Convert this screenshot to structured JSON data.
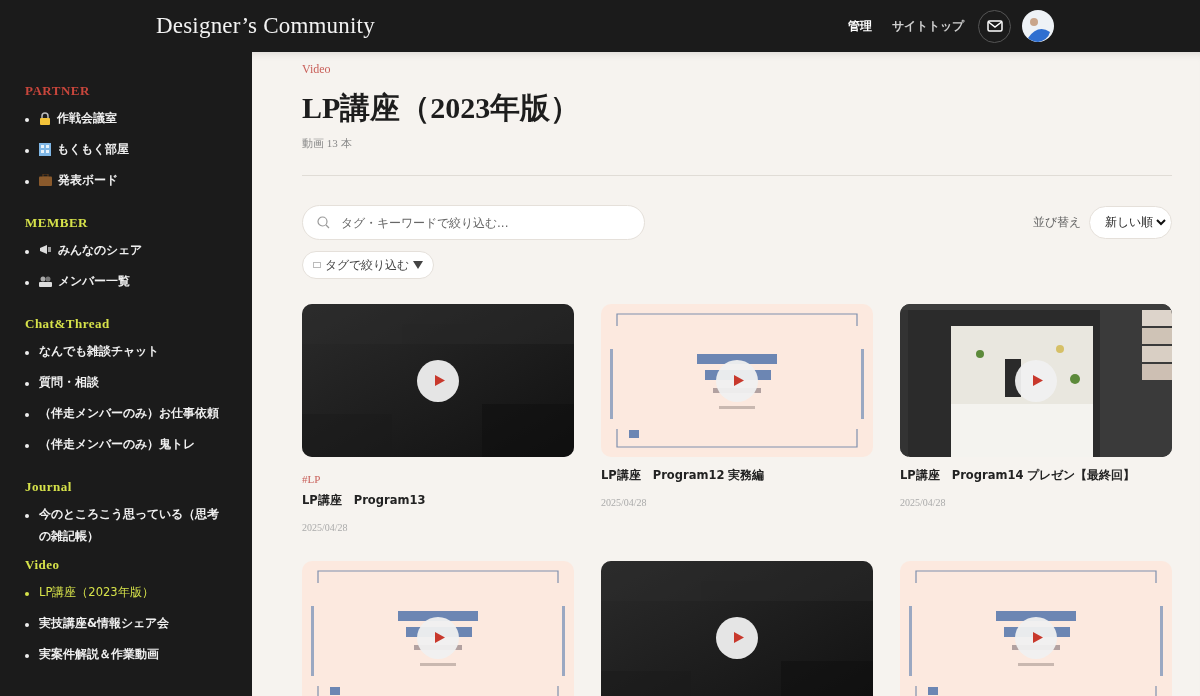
{
  "header": {
    "title": "Designer’s Community",
    "nav": [
      {
        "label": "管理",
        "selected": true
      },
      {
        "label": "サイトトップ",
        "selected": false
      }
    ]
  },
  "sidebar": {
    "sections": [
      {
        "heading": "PARTNER",
        "color": "#c8463c",
        "items": [
          {
            "label": "作戦会議室",
            "kind": "lock",
            "selected": false
          },
          {
            "label": "もくもく部屋",
            "kind": "building",
            "selected": false
          },
          {
            "label": "発表ボード",
            "kind": "briefcase",
            "selected": false
          }
        ]
      },
      {
        "heading": "MEMBER",
        "color": "#d6e24a",
        "items": [
          {
            "label": "みんなのシェア",
            "kind": "megaphone",
            "selected": false
          },
          {
            "label": "メンバー一覧",
            "kind": "people",
            "selected": false
          }
        ]
      },
      {
        "heading": "Chat&Thread",
        "color": "#d6e24a",
        "items": [
          {
            "label": "なんでも雑談チャット",
            "selected": false
          },
          {
            "label": "質問・相談",
            "selected": false
          },
          {
            "label": "（伴走メンバーのみ）お仕事依頼",
            "selected": false
          },
          {
            "label": "（伴走メンバーのみ）鬼トレ",
            "selected": false
          }
        ]
      },
      {
        "heading": "Journal",
        "color": "#d6e24a",
        "items": [
          {
            "label": "今のところこう思っている（思考の雑記帳）",
            "selected": false
          }
        ]
      },
      {
        "heading": "Video",
        "color": "#d6e24a",
        "items": [
          {
            "label": "LP講座（2023年版）",
            "selected": true
          },
          {
            "label": "実技講座&情報シェア会",
            "selected": false
          },
          {
            "label": "実案件解説＆作業動画",
            "selected": false
          }
        ]
      }
    ]
  },
  "main": {
    "category": "Video",
    "title": "LP講座（2023年版）",
    "count": "動画 13 本",
    "search": {
      "placeholder": "タグ・キーワードで絞り込む..."
    },
    "tag_filter": "タグで絞り込む",
    "sort": {
      "label": "並び替え",
      "value": "新しい順"
    },
    "videos": [
      {
        "kind": "dark",
        "tag": "#LP",
        "title": "LP講座　Program13",
        "date": "2025/04/28"
      },
      {
        "kind": "pink",
        "title": "LP講座　Program12 実務編",
        "date": "2025/04/28"
      },
      {
        "kind": "screen",
        "title": "LP講座　Program14 プレゼン【最終回】",
        "date": "2025/04/28"
      },
      {
        "kind": "pink"
      },
      {
        "kind": "dark"
      },
      {
        "kind": "pink"
      }
    ]
  }
}
